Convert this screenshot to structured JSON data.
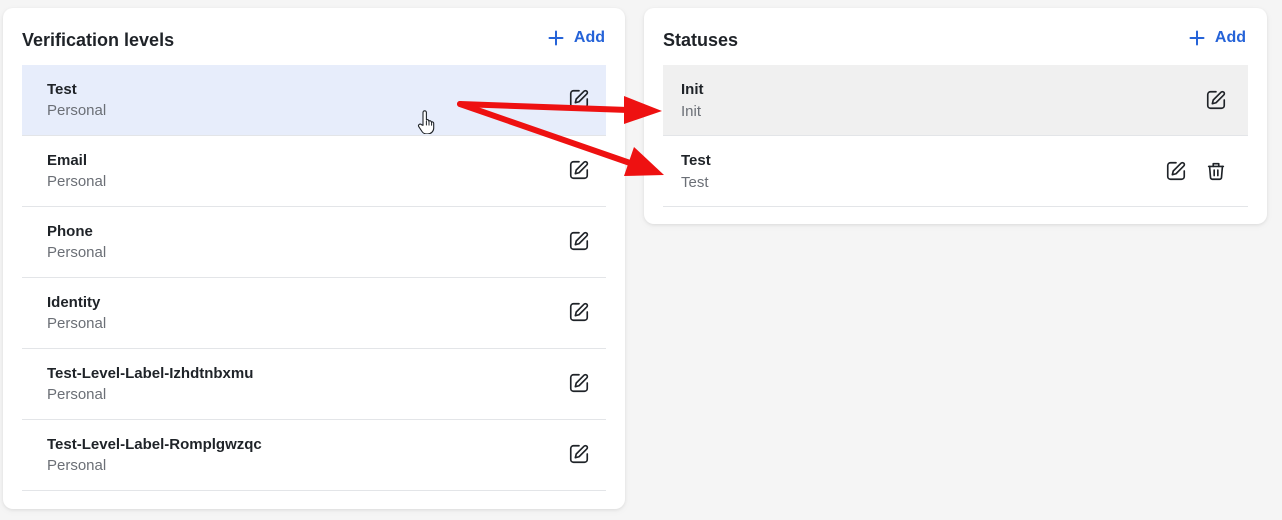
{
  "left_panel": {
    "title": "Verification levels",
    "add_label": "Add",
    "items": [
      {
        "title": "Test",
        "subtitle": "Personal"
      },
      {
        "title": "Email",
        "subtitle": "Personal"
      },
      {
        "title": "Phone",
        "subtitle": "Personal"
      },
      {
        "title": "Identity",
        "subtitle": "Personal"
      },
      {
        "title": "Test-Level-Label-Izhdtnbxmu",
        "subtitle": "Personal"
      },
      {
        "title": "Test-Level-Label-Romplgwzqc",
        "subtitle": "Personal"
      }
    ]
  },
  "right_panel": {
    "title": "Statuses",
    "add_label": "Add",
    "items": [
      {
        "title": "Init",
        "subtitle": "Init"
      },
      {
        "title": "Test",
        "subtitle": "Test"
      }
    ]
  },
  "icons": {
    "add": "plus-icon",
    "edit": "pencil-icon",
    "delete": "trash-icon",
    "cursor": "hand-pointer-icon"
  },
  "colors": {
    "accent": "#2563d8",
    "selected_row": "#e7edfb",
    "hovered_row": "#f0f0f0",
    "annotation_arrow": "#ee1111"
  }
}
